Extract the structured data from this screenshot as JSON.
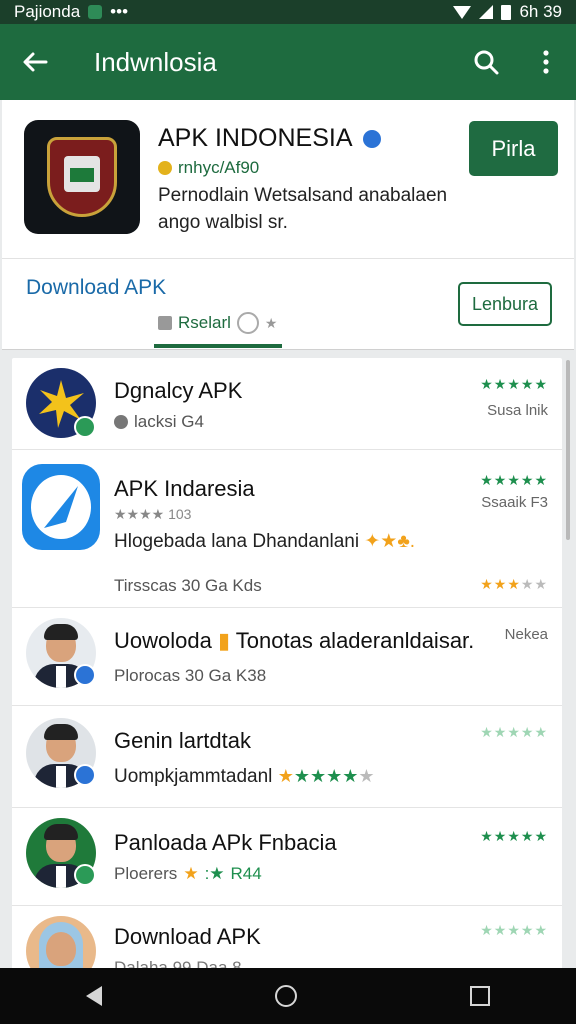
{
  "status_bar": {
    "left_text": "Pajionda",
    "time": "6h 39"
  },
  "app_bar": {
    "title": "Indwnlosia"
  },
  "header": {
    "app_name": "APK INDONESIA",
    "developer": "rnhyc/Af90",
    "description": "Pernodlain Wetsalsand anabalaen ango walbisl sr.",
    "primary_button": "Pirla",
    "download_link": "Download APK",
    "meta_label": "Rselarl",
    "outline_button": "Lenbura"
  },
  "list": [
    {
      "title": "Dgnalcy APK",
      "subtitle": "lacksi G4",
      "right_label": "Susa lnik",
      "stars": "★★★★★"
    },
    {
      "title": "APK Indaresia",
      "rating": "★★★★ 103",
      "right_label": "Ssaaik F3",
      "description": "Hlogebada lana Dhandanlani",
      "meta": "Tirsscas 30 Ga Kds",
      "stars": "★★★★★"
    },
    {
      "title": "Uowoloda ",
      "title_rest": "Tonotas aladeranldaisar...",
      "meta": "Plorocas 30 Ga K38",
      "right_label": "Nekea"
    },
    {
      "title": "Genin lartdtak",
      "meta": "Uompkjammtadanl",
      "stars": "★★★★★"
    },
    {
      "title": "Panloada APk Fnbacia",
      "meta": "Ploerers",
      "rating": "R44",
      "stars": "★★★★★"
    },
    {
      "title": "Download APK",
      "meta": "Dalaha 99 Daa 8"
    }
  ]
}
